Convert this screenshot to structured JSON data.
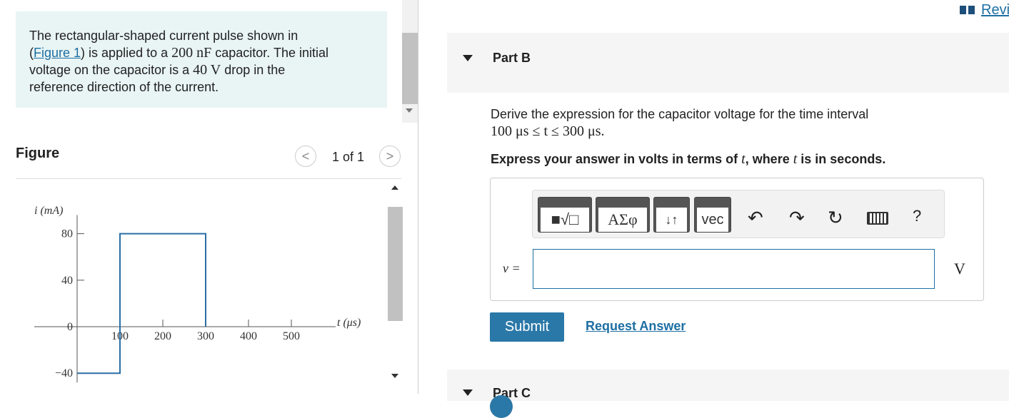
{
  "problem": {
    "t1": "The rectangular-shaped current pulse shown in",
    "t2": "(",
    "figure_link": "Figure 1",
    "t3": ") is applied to a ",
    "cap_value": "200 nF",
    "t4": " capacitor. The initial",
    "t5": "voltage on the capacitor is a ",
    "volt_value": "40 V",
    "t6": " drop in the",
    "t7": "reference direction of the current."
  },
  "figure": {
    "title": "Figure",
    "counter": "1 of 1",
    "prev": "<",
    "next": ">"
  },
  "chart_data": {
    "type": "line",
    "ylabel": "i (mA)",
    "xlabel": "t (μs)",
    "x_ticks": [
      "100",
      "200",
      "300",
      "400",
      "500"
    ],
    "y_ticks": [
      "80",
      "40",
      "0",
      "−40"
    ],
    "x": [
      0,
      100,
      100,
      300,
      300
    ],
    "y": [
      -40,
      -40,
      80,
      80,
      0
    ],
    "xlim": [
      0,
      600
    ],
    "ylim": [
      -40,
      80
    ],
    "line_color": "#2a6ea6"
  },
  "review": {
    "label": "Revi",
    "icon": "book-icon"
  },
  "partB": {
    "title": "Part B",
    "question_line1": "Derive the expression for the capacitor voltage for the time interval",
    "question_line2": "100 μs ≤ t ≤  300 μs.",
    "instruction_pre": "Express your answer in volts in terms of ",
    "instruction_var1": "t",
    "instruction_mid": ", where ",
    "instruction_var2": "t",
    "instruction_post": " is in seconds."
  },
  "toolbar": {
    "templates": "■√□",
    "greek": "ΑΣφ",
    "arrows": "↓↑",
    "vec": "vec",
    "undo": "↶",
    "redo": "↷",
    "reset": "↻",
    "help": "?"
  },
  "answer": {
    "var_label": "v =",
    "value": "",
    "unit": "V"
  },
  "buttons": {
    "submit": "Submit",
    "request": "Request Answer"
  },
  "partC": {
    "title": "Part C"
  },
  "colors": {
    "accent": "#2a78a8",
    "link": "#1d6fa3",
    "problem_bg": "#e9f4f4"
  }
}
